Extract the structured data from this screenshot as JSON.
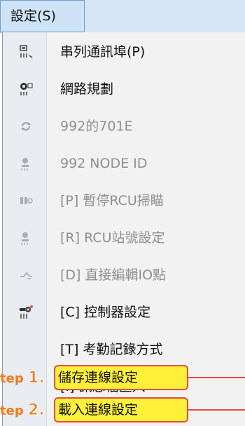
{
  "menu": {
    "title": "設定(S)"
  },
  "items": [
    {
      "label": "串列通訊埠(P)",
      "icon": "serial-port-icon",
      "disabled": false
    },
    {
      "label": "網路規劃",
      "icon": "network-icon",
      "disabled": false
    },
    {
      "label": "992的701E",
      "icon": "refresh-icon",
      "disabled": true
    },
    {
      "label": "992 NODE ID",
      "icon": "node-id-icon",
      "disabled": true
    },
    {
      "label": "[P] 暫停RCU掃瞄",
      "icon": "pause-scan-icon",
      "disabled": true
    },
    {
      "label": "[R] RCU站號設定",
      "icon": "station-number-icon",
      "disabled": true
    },
    {
      "label": "[D] 直接編輯IO點",
      "icon": "edit-io-icon",
      "disabled": true
    },
    {
      "label": "[C] 控制器設定",
      "icon": "controller-settings-icon",
      "disabled": false
    },
    {
      "label": "[T] 考勤記錄方式",
      "icon": "",
      "disabled": false
    },
    {
      "label": "[I] 訊息檔匯入",
      "icon": "",
      "disabled": false
    }
  ],
  "annotations": [
    {
      "step_prefix": "tep",
      "step_number": "1.",
      "label": "儲存連線設定"
    },
    {
      "step_prefix": "tep",
      "step_number": "2.",
      "label": "載入連線設定"
    }
  ],
  "colors": {
    "highlight_fill": "#fff13a",
    "highlight_border": "#e84b3a",
    "step_text": "#f07a1a",
    "disabled_text": "#8f8f8f"
  }
}
